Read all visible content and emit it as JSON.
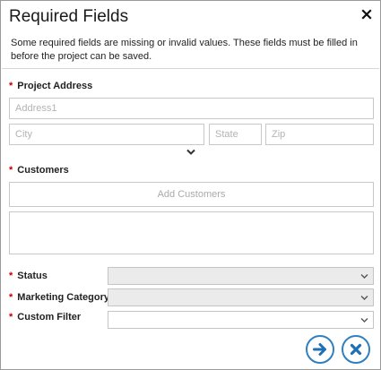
{
  "dialog": {
    "title": "Required Fields",
    "close_icon": "close-icon",
    "description": "Some required fields are missing or invalid values. These fields must be filled in before the project can be saved."
  },
  "required_marker": "*",
  "project_address": {
    "label": "Project Address",
    "address1": {
      "value": "",
      "placeholder": "Address1"
    },
    "city": {
      "value": "",
      "placeholder": "City"
    },
    "state": {
      "value": "",
      "placeholder": "State"
    },
    "zip": {
      "value": "",
      "placeholder": "Zip"
    },
    "expand_icon": "chevron-down-icon"
  },
  "customers": {
    "label": "Customers",
    "add_button_label": "Add Customers",
    "items": []
  },
  "status": {
    "label": "Status",
    "selected": ""
  },
  "marketing_category": {
    "label": "Marketing Category",
    "selected": ""
  },
  "custom_filter": {
    "label": "Custom Filter",
    "selected": ""
  },
  "actions": {
    "next_icon": "arrow-right-icon",
    "cancel_icon": "close-circle-icon"
  },
  "colors": {
    "accent": "#2f7fc1",
    "required": "#c00000",
    "border": "#c8c8c8",
    "disabled_select": "#ebebeb",
    "placeholder": "#b3b3b3"
  }
}
